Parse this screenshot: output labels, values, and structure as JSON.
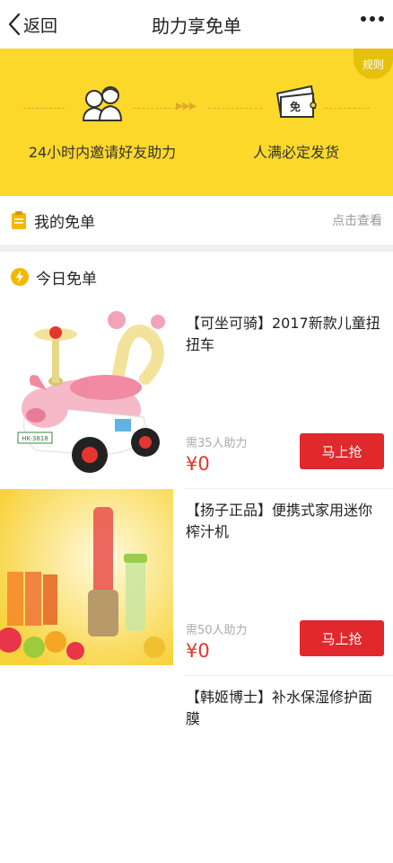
{
  "nav": {
    "back_label": "返回",
    "title": "助力享免单"
  },
  "banner": {
    "rules_label": "规则",
    "feature1": "24小时内邀请好友助力",
    "feature2": "人满必定发货",
    "coupon_char": "免"
  },
  "my_free": {
    "label": "我的免单",
    "link": "点击查看"
  },
  "today": {
    "label": "今日免单"
  },
  "products": [
    {
      "name": "【可坐可骑】2017新款儿童扭扭车",
      "need": "需35人助力",
      "price": "¥0",
      "button": "马上抢",
      "plate": "HK-3818"
    },
    {
      "name": "【扬子正品】便携式家用迷你榨汁机",
      "need": "需50人助力",
      "price": "¥0",
      "button": "马上抢"
    },
    {
      "name": "【韩姬博士】补水保湿修护面膜"
    }
  ],
  "colors": {
    "banner": "#fcd82a",
    "accent": "#e0282d",
    "price": "#e1362b"
  }
}
